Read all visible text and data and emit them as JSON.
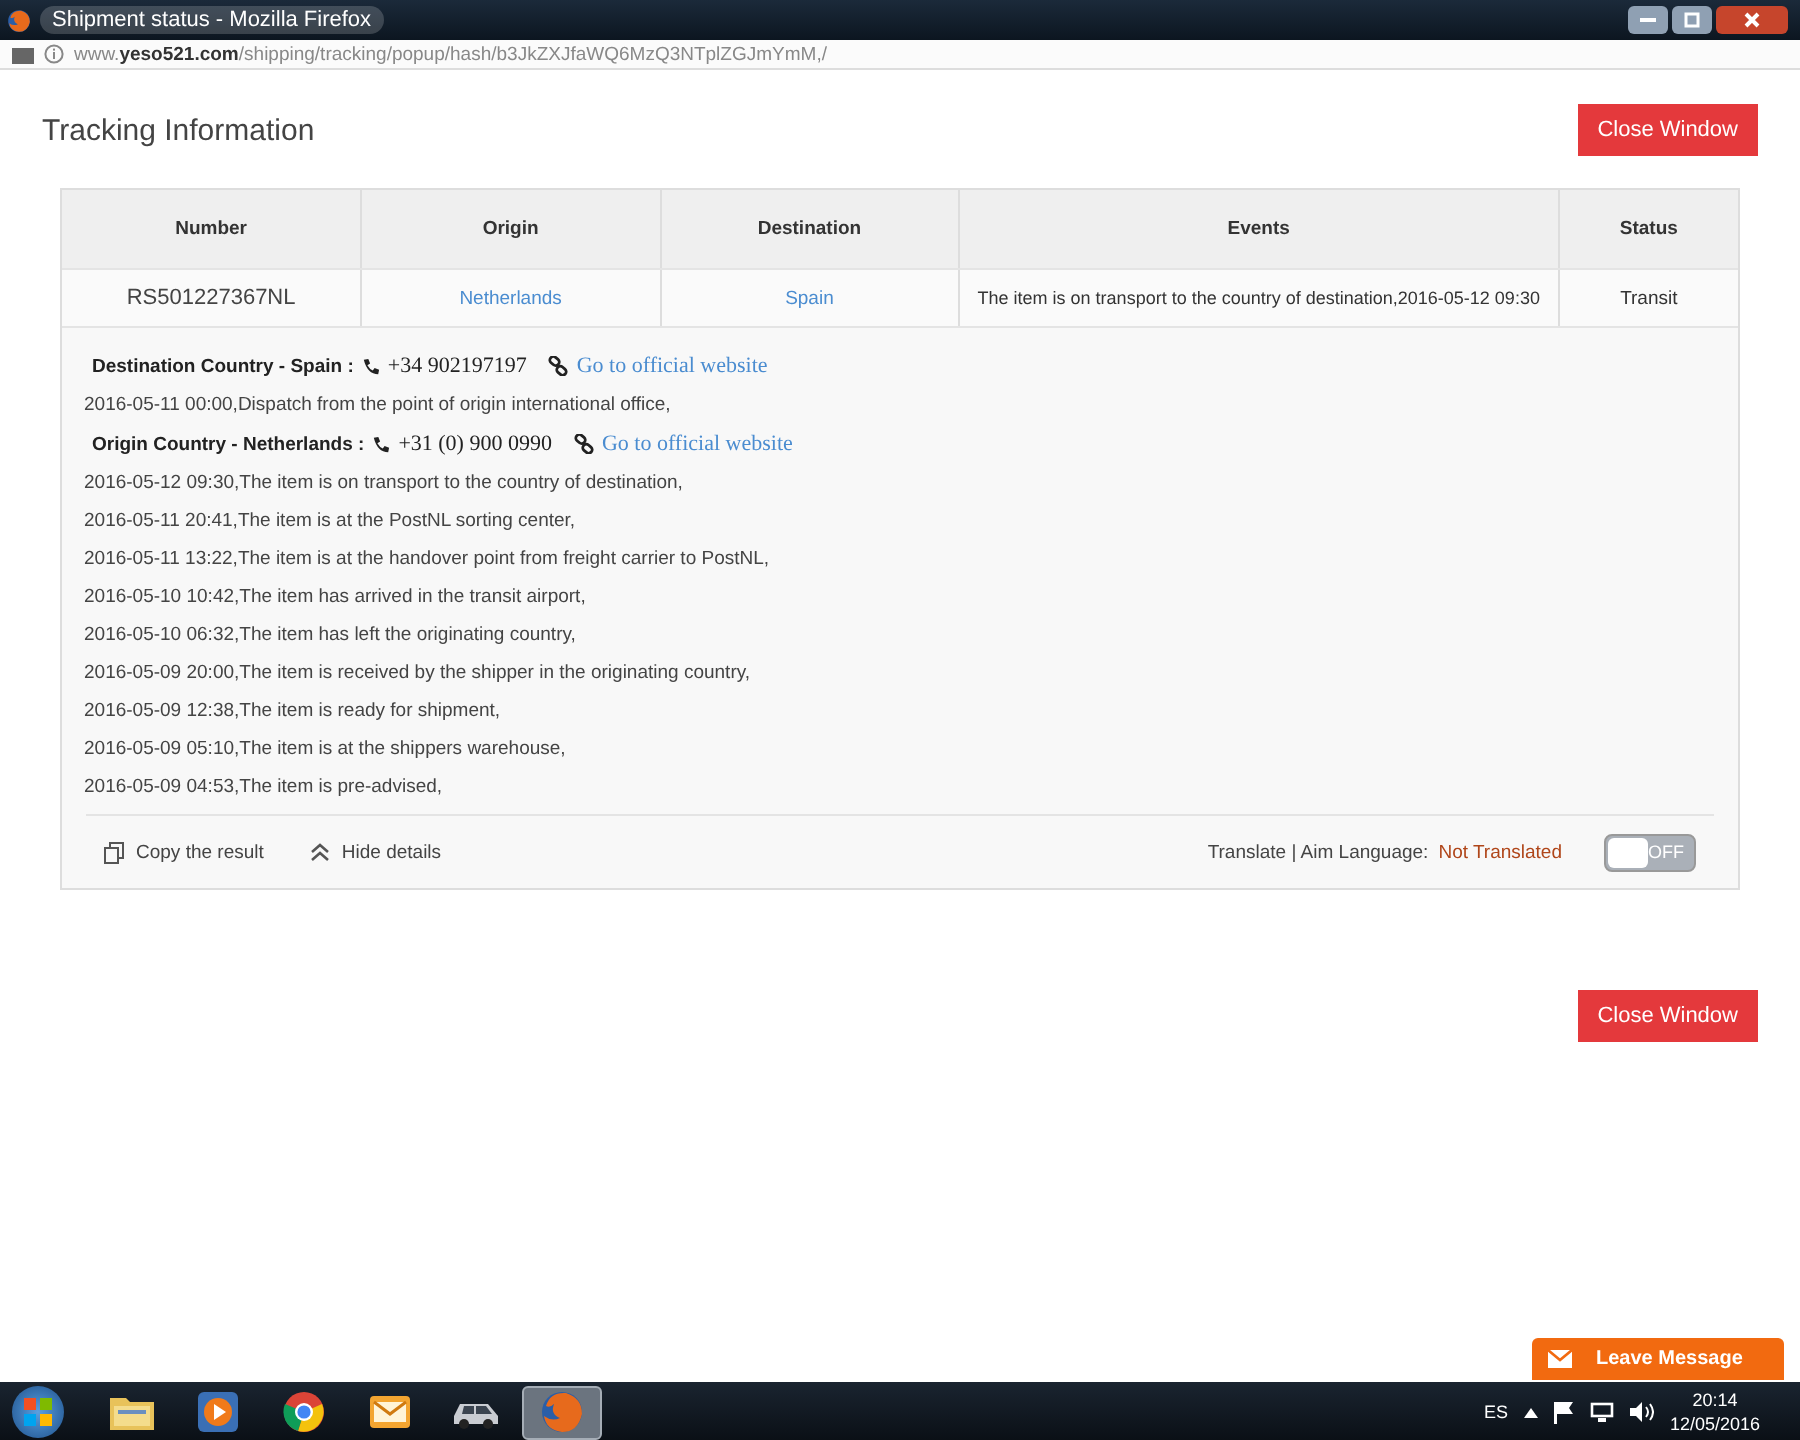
{
  "window": {
    "title": "Shipment status - Mozilla Firefox"
  },
  "address_bar": {
    "url": "www.**yeso521.com**/shipping/tracking/popup/hash/b3JkZXJfaWQ6MzQ3NTplZGJmYmM,/"
  },
  "page": {
    "title": "Tracking Information",
    "close_buttons": [
      "Close Window",
      "Close Window"
    ]
  },
  "table": {
    "columns": [
      "Number",
      "Origin",
      "Destination",
      "Events",
      "Status"
    ],
    "rows": [
      {
        "number": "RS501227367NL",
        "origin": "Netherlands",
        "destination": "Spain",
        "events": "The item is on transport to the country of destination,2016-05-12 09:30",
        "status": "Transit"
      }
    ]
  },
  "details": {
    "lines": [
      {
        "kind": "contact",
        "label": "Destination Country - Spain :",
        "phone": "+34 902197197",
        "link": "Go to official website"
      },
      {
        "kind": "event",
        "text": "2016-05-11 00:00,Dispatch from the point of origin international office,"
      },
      {
        "kind": "contact",
        "label": "Origin Country - Netherlands :",
        "phone": "+31 (0) 900 0990",
        "link": "Go to official website"
      },
      {
        "kind": "event",
        "text": "2016-05-12 09:30,The item is on transport to the country of destination,"
      },
      {
        "kind": "event",
        "text": "2016-05-11 20:41,The item is at the PostNL sorting center,"
      },
      {
        "kind": "event",
        "text": "2016-05-11 13:22,The item is at the handover point from freight carrier to PostNL,"
      },
      {
        "kind": "event",
        "text": "2016-05-10 10:42,The item has arrived in the transit airport,"
      },
      {
        "kind": "event",
        "text": "2016-05-10 06:32,The item has left the originating country,"
      },
      {
        "kind": "event",
        "text": "2016-05-09 20:00,The item is received by the shipper in the originating country,"
      },
      {
        "kind": "event",
        "text": "2016-05-09 12:38,The item is ready for shipment,"
      },
      {
        "kind": "event",
        "text": "2016-05-09 05:10,The item is at the shippers warehouse,"
      },
      {
        "kind": "event",
        "text": "2016-05-09 04:53,The item is pre-advised,"
      }
    ],
    "footer": {
      "copy": "Copy the result",
      "hide": "Hide details",
      "translate_label": "Translate | Aim Language:",
      "translate_value": "Not Translated",
      "toggle": {
        "label": "OFF",
        "on": false
      }
    }
  },
  "leave_message": "Leave Message",
  "taskbar": {
    "apps": [
      {
        "kind": "folder",
        "selected": false
      },
      {
        "kind": "player",
        "selected": false
      },
      {
        "kind": "browser",
        "selected": false
      },
      {
        "kind": "mail",
        "selected": false
      },
      {
        "kind": "car",
        "selected": false
      },
      {
        "kind": "firefox",
        "selected": true
      }
    ],
    "language": "ES",
    "time": "20:14",
    "date": "12/05/2016"
  }
}
